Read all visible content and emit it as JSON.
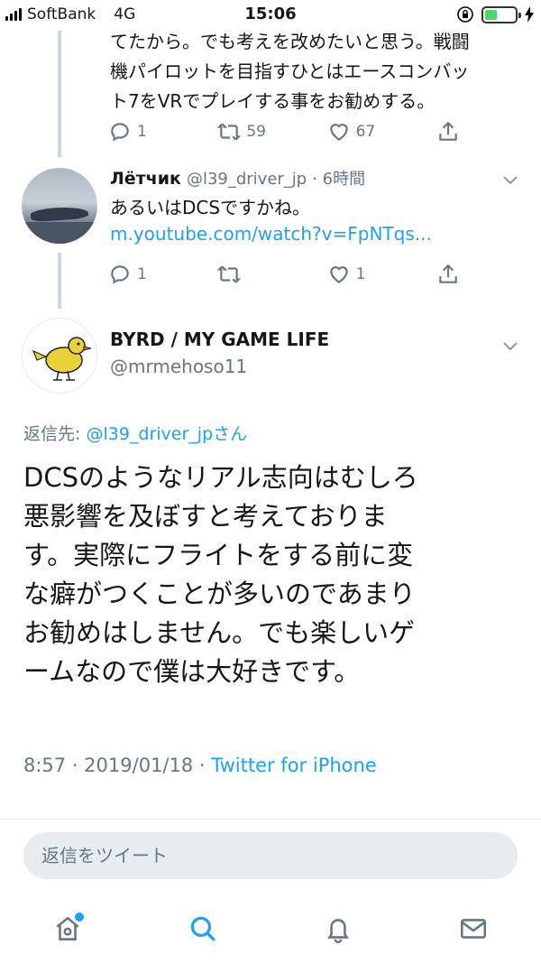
{
  "status_bar": {
    "carrier": "SoftBank",
    "network": "4G",
    "time": "15:06"
  },
  "previous_tweet": {
    "text_lines": [
      "てたから。でも考えを改めたいと思う。戦闘",
      "機パイロットを目指すひとはエースコンバッ",
      "ト7をVRでプレイする事をお勧めする。"
    ],
    "actions": {
      "reply_count": "1",
      "retweet_count": "59",
      "like_count": "67"
    }
  },
  "reply_tweet": {
    "name": "Лётчик",
    "handle": "@l39_driver_jp",
    "time": "· 6時間",
    "text": "あるいはDCSですかね。",
    "link": "m.youtube.com/watch?v=FpNTqs...",
    "actions": {
      "reply_count": "1",
      "retweet_count": "",
      "like_count": "1"
    }
  },
  "main_tweet": {
    "name": "BYRD / MY GAME LIFE",
    "handle": "@mrmehoso11",
    "reply_to_label": "返信先: ",
    "reply_to_user": "@l39_driver_jpさん",
    "text_lines": [
      "DCSのようなリアル志向はむしろ",
      "悪影響を及ぼすと考えておりま",
      "す。実際にフライトをする前に変",
      "な癖がつくことが多いのであまり",
      "お勧めはしません。でも楽しいゲ",
      "ームなので僕は大好きです。"
    ],
    "timestamp": "8:57 · 2019/01/18 · ",
    "source": "Twitter for iPhone"
  },
  "compose": {
    "placeholder": "返信をツイート"
  },
  "tab_bar": {
    "items": [
      "home-icon",
      "search-icon",
      "notifications-icon",
      "messages-icon"
    ],
    "active": "search-icon"
  },
  "colors": {
    "accent": "#1da1f2",
    "secondary_text": "#657786",
    "battery": "#4cd964"
  }
}
